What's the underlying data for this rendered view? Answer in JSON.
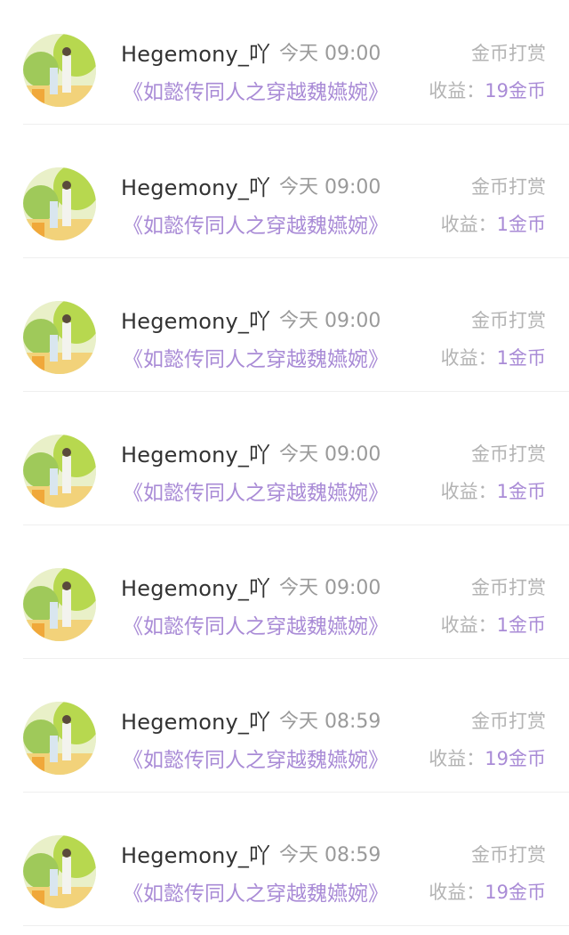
{
  "records": [
    {
      "user": "Hegemony_吖",
      "time": "今天 09:00",
      "type": "金币打赏",
      "book": "《如懿传同人之穿越魏嬿婉》",
      "income_label": "收益：",
      "income_amount": "19金币"
    },
    {
      "user": "Hegemony_吖",
      "time": "今天 09:00",
      "type": "金币打赏",
      "book": "《如懿传同人之穿越魏嬿婉》",
      "income_label": "收益：",
      "income_amount": "1金币"
    },
    {
      "user": "Hegemony_吖",
      "time": "今天 09:00",
      "type": "金币打赏",
      "book": "《如懿传同人之穿越魏嬿婉》",
      "income_label": "收益：",
      "income_amount": "1金币"
    },
    {
      "user": "Hegemony_吖",
      "time": "今天 09:00",
      "type": "金币打赏",
      "book": "《如懿传同人之穿越魏嬿婉》",
      "income_label": "收益：",
      "income_amount": "1金币"
    },
    {
      "user": "Hegemony_吖",
      "time": "今天 09:00",
      "type": "金币打赏",
      "book": "《如懿传同人之穿越魏嬿婉》",
      "income_label": "收益：",
      "income_amount": "1金币"
    },
    {
      "user": "Hegemony_吖",
      "time": "今天 08:59",
      "type": "金币打赏",
      "book": "《如懿传同人之穿越魏嬿婉》",
      "income_label": "收益：",
      "income_amount": "19金币"
    },
    {
      "user": "Hegemony_吖",
      "time": "今天 08:59",
      "type": "金币打赏",
      "book": "《如懿传同人之穿越魏嬿婉》",
      "income_label": "收益：",
      "income_amount": "19金币"
    }
  ],
  "colors": {
    "accent": "#a98bd6",
    "muted": "#b3b3b3",
    "username": "#333333"
  },
  "icons": {
    "avatar": "user-avatar-photo"
  }
}
